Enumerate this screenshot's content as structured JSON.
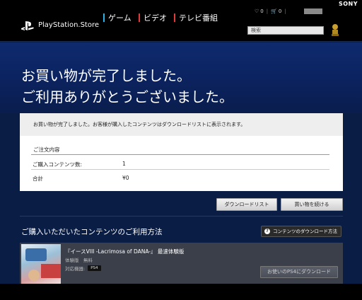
{
  "topbar": {
    "brand": "SONY"
  },
  "header": {
    "store_name": "PlayStation.Store",
    "nav": [
      {
        "label": "ゲーム",
        "color": "#2bb3e8"
      },
      {
        "label": "ビデオ",
        "color": "#e03a3a"
      },
      {
        "label": "テレビ番組",
        "color": "#e03a3a"
      }
    ],
    "wishlist_count": "0",
    "cart_count": "0",
    "search_placeholder": "検索"
  },
  "hero": {
    "title_line1": "お買い物が完了しました。",
    "title_line2": "ご利用ありがとうございました。"
  },
  "panel": {
    "message": "お買い物が完了しました。お客様が購入したコンテンツはダウンロードリストに表示されます。",
    "order_heading": "ご注文内容",
    "rows": [
      {
        "label": "ご購入コンテンツ数:",
        "value": "1"
      },
      {
        "label": "合計",
        "value": "¥0"
      }
    ]
  },
  "actions": {
    "download_list": "ダウンロードリスト",
    "continue_shopping": "買い物を続ける"
  },
  "section": {
    "title": "ご購入いただいたコンテンツのご利用方法",
    "howto_button": "コンテンツのダウンロード方法"
  },
  "item": {
    "title": "『イースVIII -Lacrimosa of DANA-』 最速体験版",
    "meta": "体験版　無料",
    "compat_label": "対応機器:",
    "platform": "PS4",
    "download_button": "お使いのPS4にダウンロード"
  }
}
